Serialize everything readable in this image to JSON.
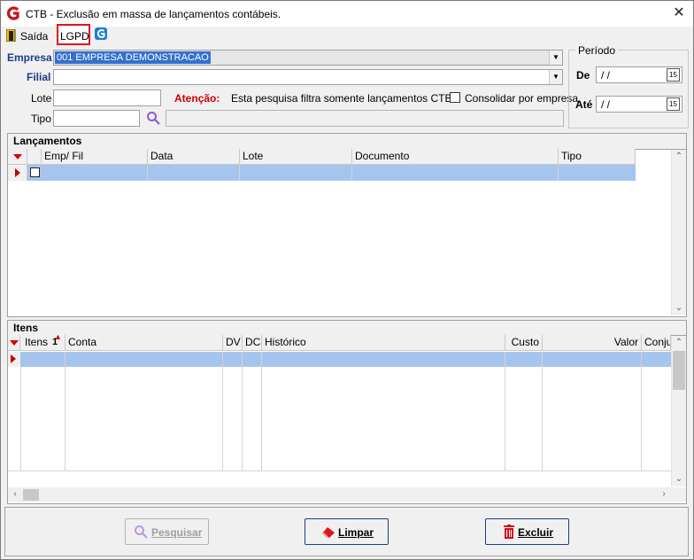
{
  "window": {
    "title": "CTB - Exclusão em massa de lançamentos contábeis.",
    "close_glyph": "✕"
  },
  "toolbar": {
    "exit_label": "Saída",
    "lgpd_label": "LGPD"
  },
  "form": {
    "empresa_label": "Empresa",
    "empresa_value": "001 EMPRESA DEMONSTRACAO",
    "filial_label": "Filial",
    "filial_value": "",
    "lote_label": "Lote",
    "lote_value": "",
    "tipo_label": "Tipo",
    "tipo_value": "",
    "tipo_desc_value": "",
    "attention_label": "Atenção:",
    "attention_text": "Esta pesquisa filtra somente lançamentos CTB.",
    "consolidate_label": "Consolidar por empresa",
    "consolidate_checked": false
  },
  "periodo": {
    "title": "Período",
    "de_label": "De",
    "de_value": "/ /",
    "ate_label": "Até",
    "ate_value": "/ /",
    "calendar_glyph": "15"
  },
  "lancamentos": {
    "title": "Lançamentos",
    "columns": [
      "Emp/ Fil",
      "Data",
      "Lote",
      "Documento",
      "Tipo"
    ]
  },
  "itens": {
    "title": "Itens",
    "columns": [
      "Itens",
      "Conta",
      "DV",
      "DC",
      "Histórico",
      "Custo",
      "Valor",
      "Conjun"
    ],
    "sort_indicator": "1"
  },
  "buttons": {
    "pesquisar": "Pesquisar",
    "limpar": "Limpar",
    "excluir": "Excluir"
  },
  "colors": {
    "accent_selection": "#3470cd",
    "row_selection": "#a6c5ee",
    "attention": "#cc0000",
    "label_blue": "#1e3a8a",
    "lgpd_border": "#e0141e"
  }
}
